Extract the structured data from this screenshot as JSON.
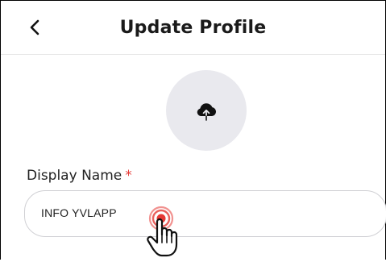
{
  "header": {
    "title": "Update Profile",
    "back_icon": "chevron-left-icon"
  },
  "avatar": {
    "icon": "cloud-upload-icon",
    "background_color": "#e9e9ee"
  },
  "form": {
    "display_name": {
      "label": "Display Name",
      "required_mark": "*",
      "value": "INFO YVLAPP"
    }
  },
  "colors": {
    "required": "#e53935",
    "tap_ring": "#e53935"
  },
  "overlay": {
    "tap_icon": "hand-pointer-icon"
  }
}
